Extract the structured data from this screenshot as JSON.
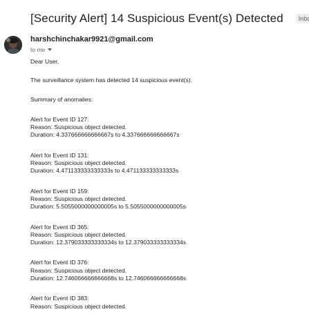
{
  "email": {
    "subject": "[Security Alert] 14 Suspicious Event(s) Detected",
    "label": "Inbox",
    "label_close": "×",
    "sender": "harshchinchakar9921@gmail.com",
    "recipient_line": "to me",
    "greeting": "Dear User,",
    "intro": "The surveillance system has detected 14 suspicious event(s).",
    "summary_heading": "Summary of anomalies:",
    "events": [
      {
        "title": "Alert for Event ID 127:",
        "reason": "Reason: Suspicious object detected.",
        "duration": "Duration: 4.337666666666667s to 4.337666666666667s"
      },
      {
        "title": "Alert for Event ID 131:",
        "reason": "Reason: Suspicious object detected.",
        "duration": "Duration: 4.471133333333333s to 4.471133333333333s"
      },
      {
        "title": "Alert for Event ID 159:",
        "reason": "Reason: Suspicious object detected.",
        "duration": "Duration: 5.5055000000000005s to 5.5055000000000005s"
      },
      {
        "title": "Alert for Event ID 365:",
        "reason": "Reason: Suspicious object detected.",
        "duration": "Duration: 12.379033333333334s to 12.379033333333334s"
      },
      {
        "title": "Alert for Event ID 376:",
        "reason": "Reason: Suspicious object detected.",
        "duration": "Duration: 12.746066666666668s to 12.746066666666668s"
      },
      {
        "title": "Alert for Event ID 383:",
        "reason": "Reason: Suspicious object detected.",
        "duration": ""
      }
    ]
  },
  "icons": {
    "important_marker": "label-important-icon",
    "avatar": "sender-avatar",
    "recipient_caret": "chevron-down-icon"
  }
}
